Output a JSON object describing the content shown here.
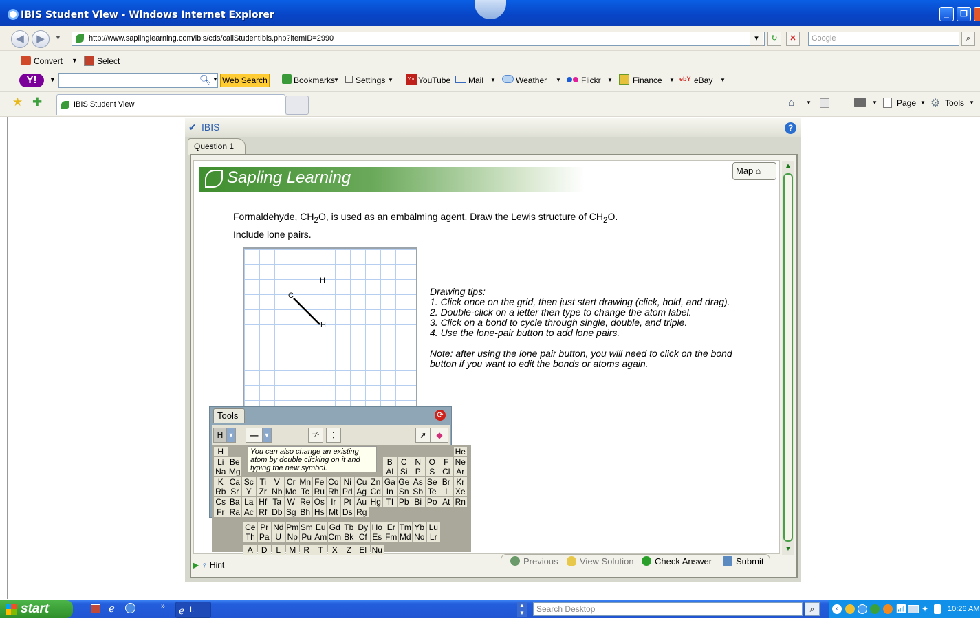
{
  "window": {
    "title": "IBIS Student View - Windows Internet Explorer"
  },
  "address_bar": {
    "url": "http://www.saplinglearning.com/ibis/cds/callStudentIbis.php?itemID=2990",
    "search_placeholder": "Google"
  },
  "command_bar": {
    "convert": "Convert",
    "select": "Select"
  },
  "yahoo_bar": {
    "web_search": "Web Search",
    "bookmarks": "Bookmarks",
    "settings": "Settings",
    "youtube": "YouTube",
    "mail": "Mail",
    "weather": "Weather",
    "flickr": "Flickr",
    "finance": "Finance",
    "ebay": "eBay"
  },
  "tabs": {
    "active": "IBIS Student View"
  },
  "tab_tools": {
    "page": "Page",
    "tools": "Tools"
  },
  "ibis": {
    "label": "IBIS",
    "question_tab": "Question 1",
    "banner": "Sapling Learning",
    "map_button": "Map",
    "prompt_line1_a": "Formaldehyde, CH",
    "prompt_sub1": "2",
    "prompt_line1_b": "O, is used as an embalming agent. Draw the Lewis structure of CH",
    "prompt_sub2": "2",
    "prompt_line1_c": "O.",
    "prompt_line2": "Include lone pairs.",
    "atoms": [
      "H",
      "C",
      "H"
    ],
    "tips": [
      "Drawing tips:",
      "1. Click once on the grid, then just start drawing (click, hold, and drag).",
      "2. Double-click on a letter then type to change the atom label.",
      "3. Click on a bond to cycle through single, double, and triple.",
      "4. Use the lone-pair button to add lone pairs.",
      "",
      "Note: after using the lone pair button, you will need to click on the bond",
      "button if you want to edit the bonds or atoms again."
    ],
    "tools_label": "Tools",
    "atom_select": "H",
    "charge_btn": "+⁄-",
    "tooltip": "You can also change an existing atom by double clicking on it and typing the new symbol.",
    "hint": "Hint",
    "previous": "Previous",
    "view_solution": "View Solution",
    "check_answer": "Check Answer",
    "submit": "Submit"
  },
  "periodic_rows": [
    [
      "H",
      "",
      "",
      "",
      "",
      "",
      "",
      "",
      "",
      "",
      "",
      "",
      "",
      "",
      "",
      "",
      "",
      "He"
    ],
    [
      "Li",
      "Be",
      "",
      "",
      "",
      "",
      "",
      "",
      "",
      "",
      "",
      "",
      "B",
      "C",
      "N",
      "O",
      "F",
      "Ne"
    ],
    [
      "Na",
      "Mg",
      "",
      "",
      "",
      "",
      "",
      "",
      "",
      "",
      "",
      "",
      "Al",
      "Si",
      "P",
      "S",
      "Cl",
      "Ar"
    ],
    [
      "K",
      "Ca",
      "Sc",
      "Ti",
      "V",
      "Cr",
      "Mn",
      "Fe",
      "Co",
      "Ni",
      "Cu",
      "Zn",
      "Ga",
      "Ge",
      "As",
      "Se",
      "Br",
      "Kr"
    ],
    [
      "Rb",
      "Sr",
      "Y",
      "Zr",
      "Nb",
      "Mo",
      "Tc",
      "Ru",
      "Rh",
      "Pd",
      "Ag",
      "Cd",
      "In",
      "Sn",
      "Sb",
      "Te",
      "I",
      "Xe"
    ],
    [
      "Cs",
      "Ba",
      "La",
      "Hf",
      "Ta",
      "W",
      "Re",
      "Os",
      "Ir",
      "Pt",
      "Au",
      "Hg",
      "Tl",
      "Pb",
      "Bi",
      "Po",
      "At",
      "Rn"
    ],
    [
      "Fr",
      "Ra",
      "Ac",
      "Rf",
      "Db",
      "Sg",
      "Bh",
      "Hs",
      "Mt",
      "Ds",
      "Rg",
      "",
      "",
      "",
      "",
      "",
      "",
      ""
    ]
  ],
  "lanthanides": [
    "Ce",
    "Pr",
    "Nd",
    "Pm",
    "Sm",
    "Eu",
    "Gd",
    "Tb",
    "Dy",
    "Ho",
    "Er",
    "Tm",
    "Yb",
    "Lu"
  ],
  "actinides": [
    "Th",
    "Pa",
    "U",
    "Np",
    "Pu",
    "Am",
    "Cm",
    "Bk",
    "Cf",
    "Es",
    "Fm",
    "Md",
    "No",
    "Lr"
  ],
  "special_atoms": [
    "A",
    "D",
    "L",
    "M",
    "R",
    "T",
    "X",
    "Z",
    "El",
    "Nu"
  ],
  "taskbar": {
    "start": "start",
    "item": "I.",
    "search_placeholder": "Search Desktop",
    "clock": "10:26 AM"
  }
}
